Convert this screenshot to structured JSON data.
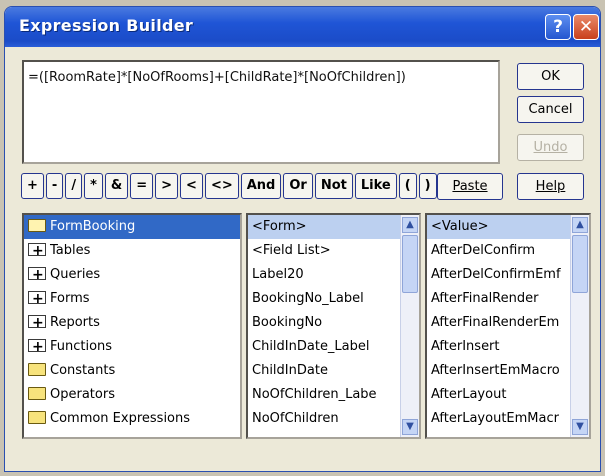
{
  "window": {
    "title": "Expression Builder",
    "help_symbol": "?",
    "close_symbol": "✕"
  },
  "expression": {
    "value": "=([RoomRate]*[NoOfRooms]+[ChildRate]*[NoOfChildren])"
  },
  "buttons": {
    "ok": "OK",
    "cancel": "Cancel",
    "undo": "Undo",
    "paste": "Paste",
    "help": "Help"
  },
  "operators": [
    "+",
    "-",
    "/",
    "*",
    "&",
    "=",
    ">",
    "<",
    "<>",
    "And",
    "Or",
    "Not",
    "Like",
    "(",
    ")"
  ],
  "folders": [
    {
      "label": "FormBooking",
      "icon": "open-folder-icon"
    },
    {
      "label": "Tables",
      "icon": "expand-folder-icon"
    },
    {
      "label": "Queries",
      "icon": "expand-folder-icon"
    },
    {
      "label": "Forms",
      "icon": "expand-folder-icon"
    },
    {
      "label": "Reports",
      "icon": "expand-folder-icon"
    },
    {
      "label": "Functions",
      "icon": "expand-folder-icon"
    },
    {
      "label": "Constants",
      "icon": "folder-icon"
    },
    {
      "label": "Operators",
      "icon": "folder-icon"
    },
    {
      "label": "Common Expressions",
      "icon": "folder-icon"
    }
  ],
  "elements": [
    "<Form>",
    "<Field List>",
    "Label20",
    "BookingNo_Label",
    "BookingNo",
    "ChildInDate_Label",
    "ChildInDate",
    "NoOfChildren_Labe",
    "NoOfChildren"
  ],
  "values": [
    "<Value>",
    "AfterDelConfirm",
    "AfterDelConfirmEmf",
    "AfterFinalRender",
    "AfterFinalRenderEm",
    "AfterInsert",
    "AfterInsertEmMacro",
    "AfterLayout",
    "AfterLayoutEmMacr"
  ],
  "colors": {
    "titlebar": "#1f55d6",
    "selection": "#3169c6",
    "dialog": "#ece9d8"
  }
}
